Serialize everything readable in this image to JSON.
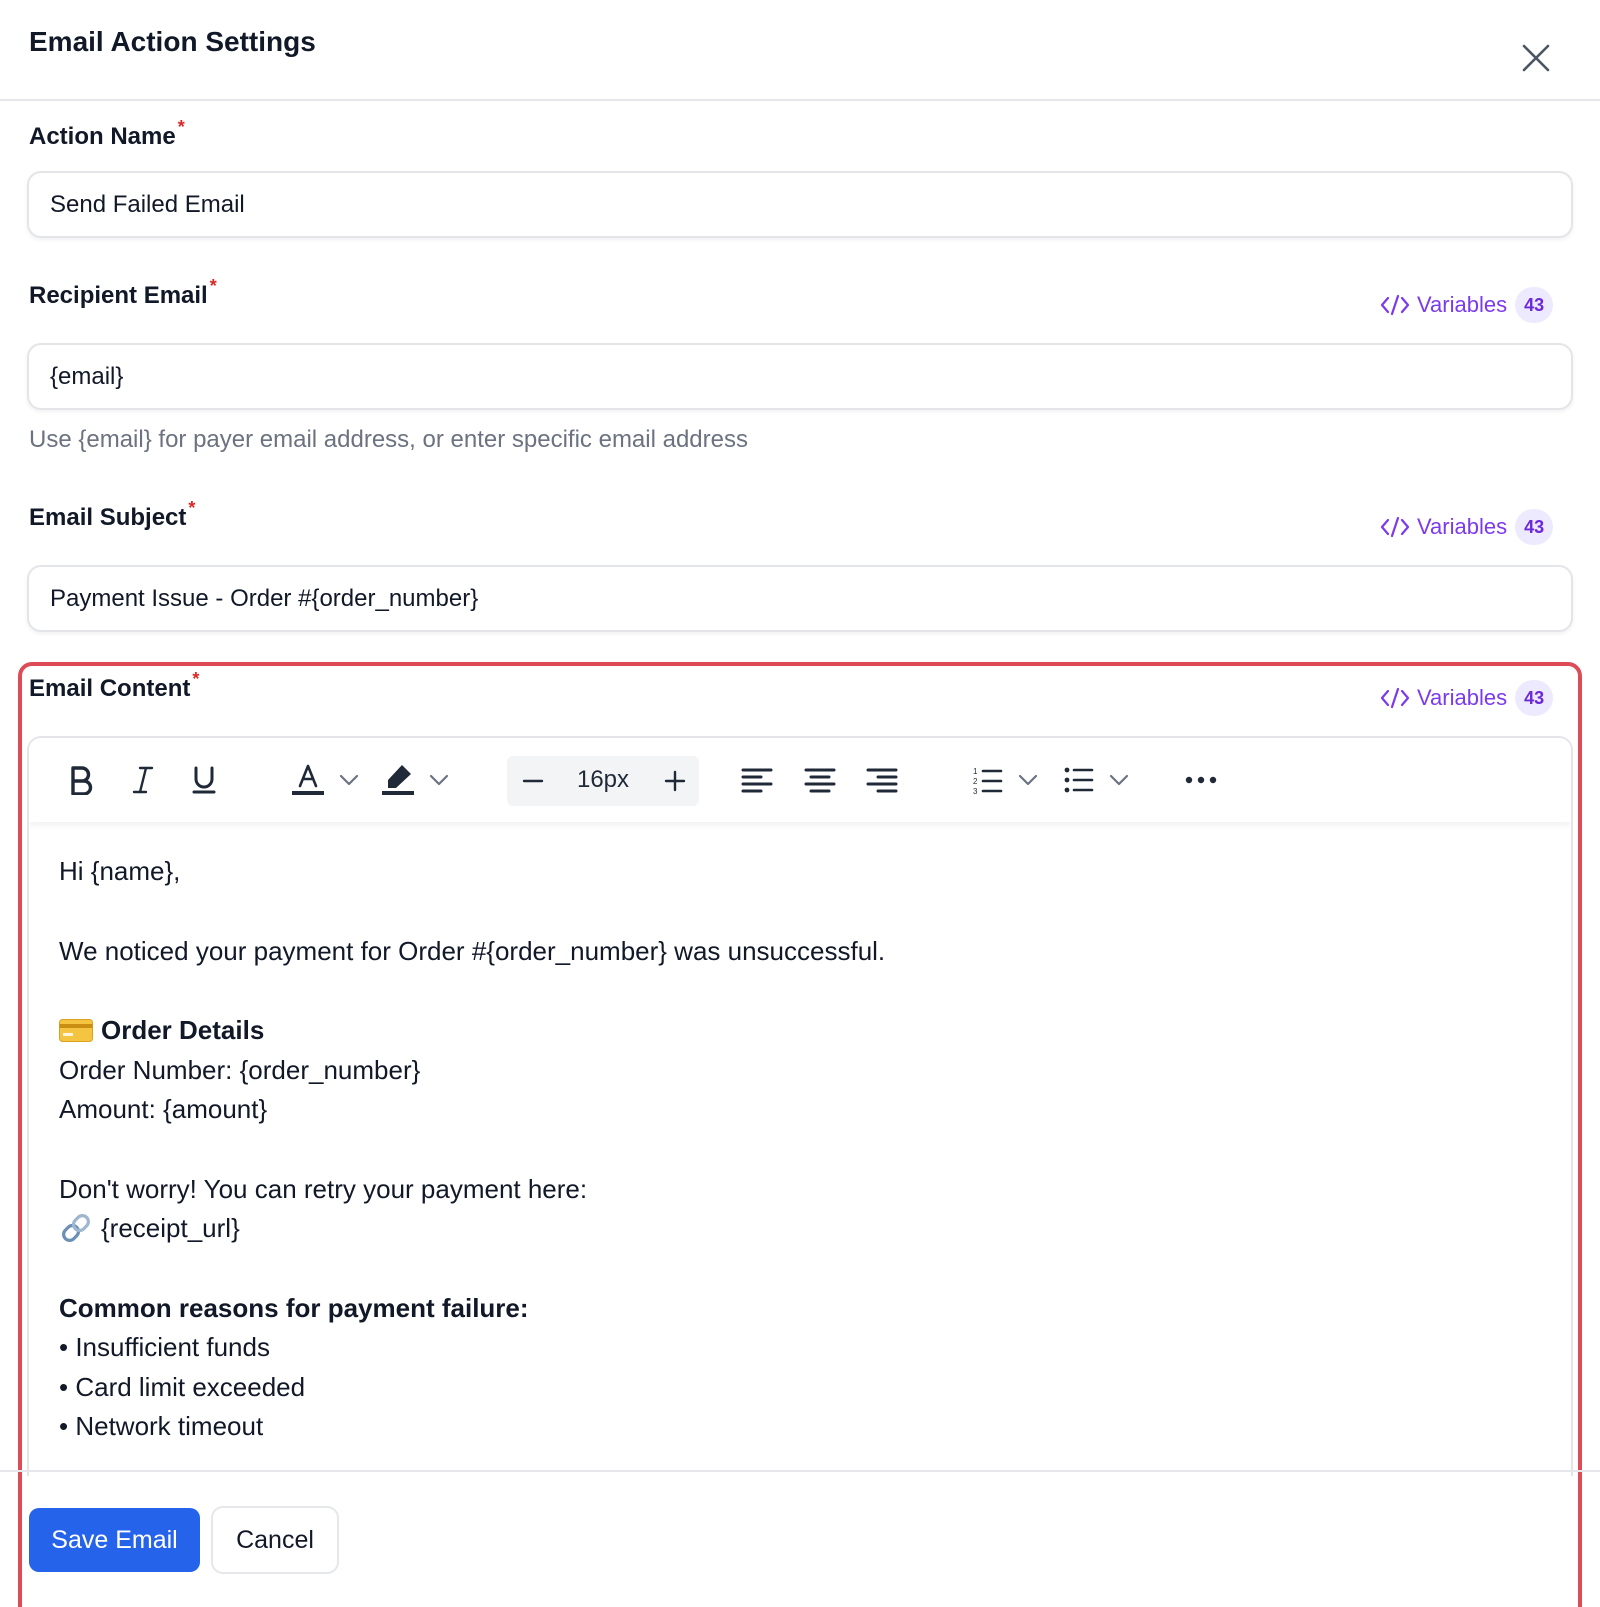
{
  "modal": {
    "title": "Email Action Settings",
    "close_icon": "close-icon"
  },
  "fields": {
    "action_name": {
      "label": "Action Name",
      "required_mark": "*",
      "value": "Send Failed Email"
    },
    "recipient_email": {
      "label": "Recipient Email",
      "required_mark": "*",
      "value": "{email}",
      "help": "Use {email} for payer email address, or enter specific email address"
    },
    "email_subject": {
      "label": "Email Subject",
      "required_mark": "*",
      "value": "Payment Issue - Order #{order_number}"
    },
    "email_content": {
      "label": "Email Content",
      "required_mark": "*"
    }
  },
  "variables": {
    "label": "Variables",
    "count": "43",
    "icon": "code-icon"
  },
  "toolbar": {
    "font_size": "16px",
    "icons": [
      "bold-icon",
      "italic-icon",
      "underline-icon",
      "text-color-icon",
      "highlight-icon",
      "font-size-decrease-icon",
      "font-size-increase-icon",
      "align-left-icon",
      "align-center-icon",
      "align-right-icon",
      "ordered-list-icon",
      "bullet-list-icon",
      "more-icon"
    ]
  },
  "content": {
    "greeting": "Hi {name},",
    "intro": "We noticed your payment for Order #{order_number} was unsuccessful.",
    "details_heading": "Order Details",
    "order_number_line": "Order Number: {order_number}",
    "amount_line": "Amount: {amount}",
    "retry_line": "Don't worry! You can retry your payment here:",
    "receipt_url": "{receipt_url}",
    "reasons_heading": "Common reasons for payment failure:",
    "reasons": [
      "• Insufficient funds",
      "• Card limit exceeded",
      "• Network timeout"
    ]
  },
  "actions": {
    "save": "Save Email",
    "cancel": "Cancel"
  },
  "colors": {
    "accent": "#7c3aed",
    "primary": "#2563eb",
    "required": "#dc2626",
    "error_border": "#dc4b56"
  }
}
